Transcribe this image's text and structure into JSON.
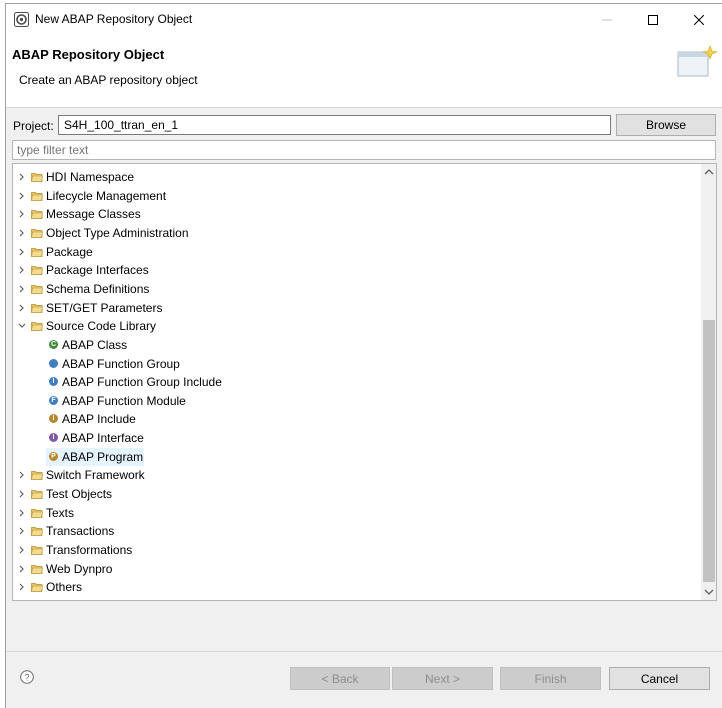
{
  "window": {
    "title": "New ABAP Repository Object"
  },
  "header": {
    "title": "ABAP Repository Object",
    "description": "Create an ABAP repository object"
  },
  "project": {
    "label": "Project:",
    "value": "S4H_100_ttran_en_1",
    "browse_label": "Browse"
  },
  "filter": {
    "placeholder": "type filter text"
  },
  "tree": {
    "items": [
      {
        "label": "HDI Namespace",
        "expanded": false
      },
      {
        "label": "Lifecycle Management",
        "expanded": false
      },
      {
        "label": "Message Classes",
        "expanded": false
      },
      {
        "label": "Object Type Administration",
        "expanded": false
      },
      {
        "label": "Package",
        "expanded": false
      },
      {
        "label": "Package Interfaces",
        "expanded": false
      },
      {
        "label": "Schema Definitions",
        "expanded": false
      },
      {
        "label": "SET/GET Parameters",
        "expanded": false
      },
      {
        "label": "Source Code Library",
        "expanded": true
      },
      {
        "label": "Switch Framework",
        "expanded": false
      },
      {
        "label": "Test Objects",
        "expanded": false
      },
      {
        "label": "Texts",
        "expanded": false
      },
      {
        "label": "Transactions",
        "expanded": false
      },
      {
        "label": "Transformations",
        "expanded": false
      },
      {
        "label": "Web Dynpro",
        "expanded": false
      },
      {
        "label": "Others",
        "expanded": false
      }
    ],
    "children": [
      {
        "label": "ABAP Class",
        "icon": "class-icon",
        "glyph": "C",
        "color": "#3f8a3f"
      },
      {
        "label": "ABAP Function Group",
        "icon": "function-group-icon",
        "glyph": "",
        "color": "#3f7fbf"
      },
      {
        "label": "ABAP Function Group Include",
        "icon": "function-group-include-icon",
        "glyph": "I",
        "color": "#3f7fbf"
      },
      {
        "label": "ABAP Function Module",
        "icon": "function-module-icon",
        "glyph": "F",
        "color": "#3f7fbf"
      },
      {
        "label": "ABAP Include",
        "icon": "include-icon",
        "glyph": "I",
        "color": "#b8862b"
      },
      {
        "label": "ABAP Interface",
        "icon": "interface-icon",
        "glyph": "I",
        "color": "#7b5aa6"
      },
      {
        "label": "ABAP Program",
        "icon": "program-icon",
        "glyph": "P",
        "color": "#b8862b",
        "selected": true
      }
    ]
  },
  "footer": {
    "back_label": "< Back",
    "next_label": "Next >",
    "finish_label": "Finish",
    "cancel_label": "Cancel"
  },
  "colors": {
    "selection": "#e5f3ff",
    "folder": "#e8c66a",
    "disabled_button": "#cccccc"
  }
}
